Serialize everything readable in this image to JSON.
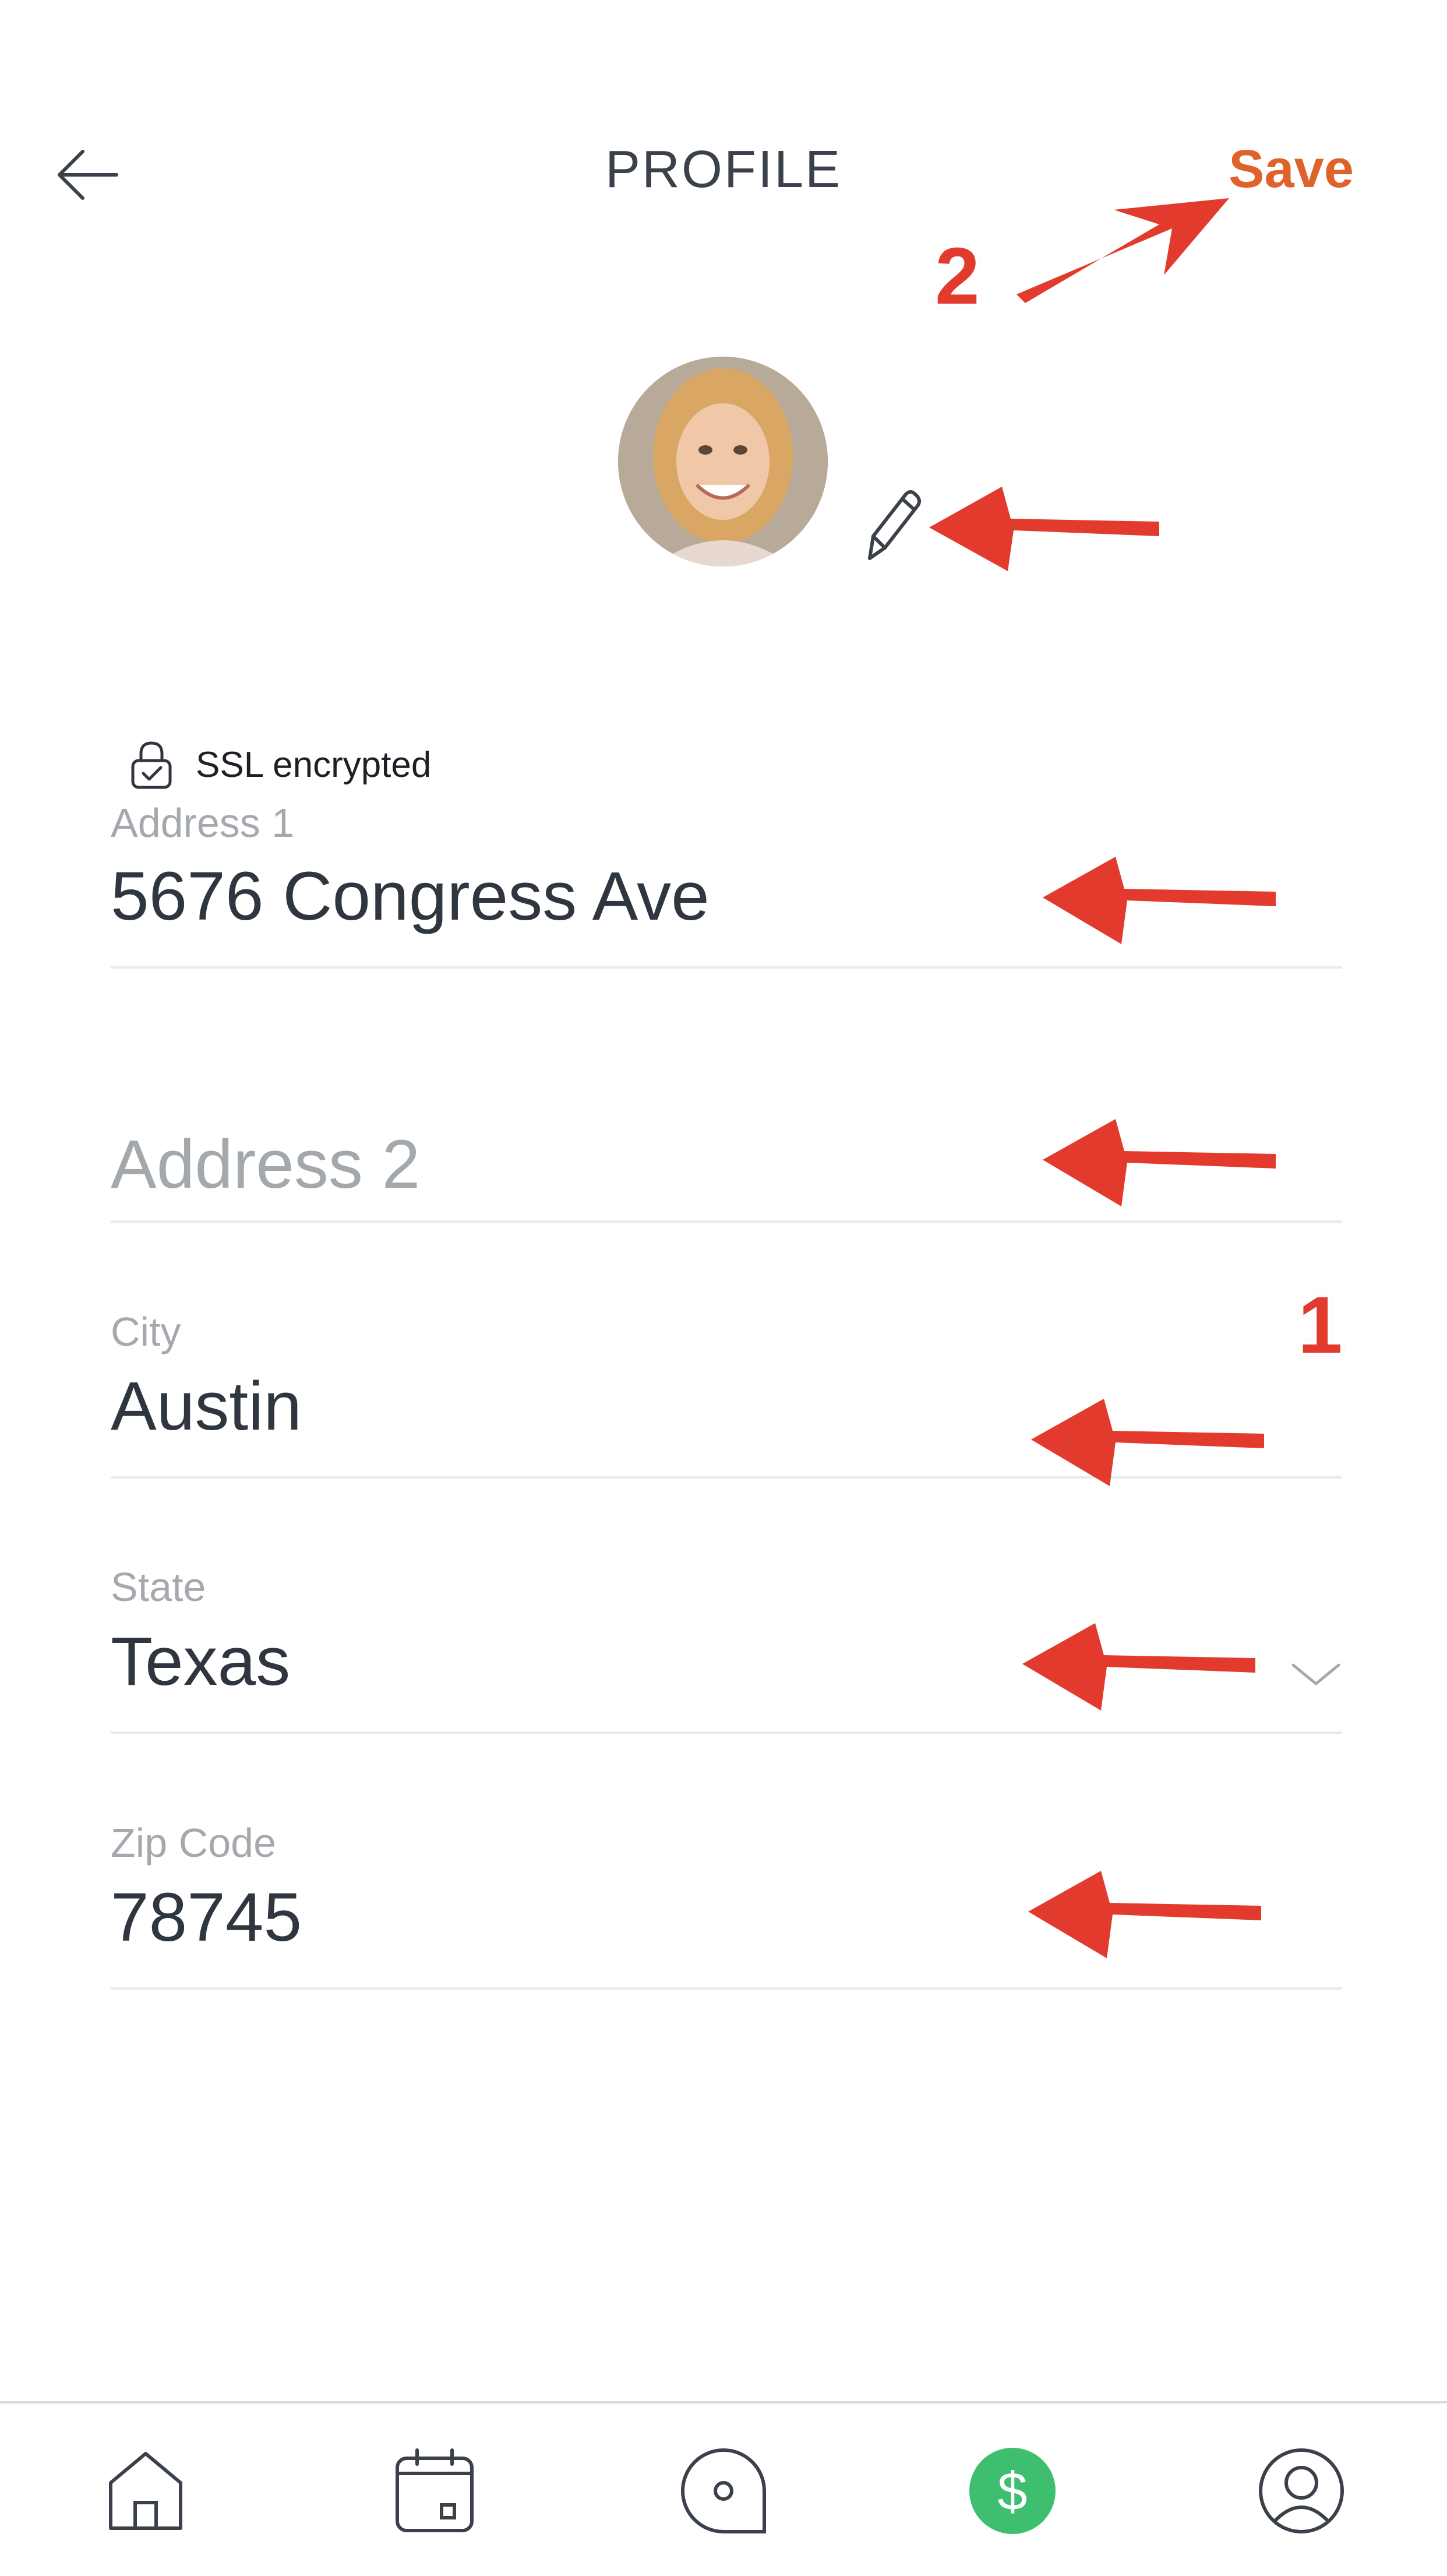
{
  "header": {
    "title": "PROFILE",
    "save_label": "Save",
    "back_icon": "arrow-left-icon"
  },
  "avatar": {
    "alt": "Profile photo",
    "edit_icon": "pencil-icon"
  },
  "security": {
    "icon": "lock-icon",
    "text": "SSL encrypted"
  },
  "form": {
    "address1": {
      "label": "Address 1",
      "value": "5676 Congress Ave"
    },
    "address2": {
      "placeholder": "Address 2",
      "value": ""
    },
    "city": {
      "label": "City",
      "value": "Austin"
    },
    "state": {
      "label": "State",
      "value": "Texas",
      "icon": "chevron-down-icon"
    },
    "zip": {
      "label": "Zip Code",
      "value": "78745"
    }
  },
  "annotations": {
    "step_one": "1",
    "step_two": "2",
    "arrow_color": "#e23b2e"
  },
  "bottom_nav": {
    "items": [
      {
        "icon": "home-icon"
      },
      {
        "icon": "calendar-icon"
      },
      {
        "icon": "chat-bubble-icon"
      },
      {
        "icon": "dollar-icon",
        "active": true,
        "color": "#3dbf6f"
      },
      {
        "icon": "profile-icon"
      }
    ]
  },
  "colors": {
    "accent": "#e0622b",
    "text": "#2f3640",
    "muted": "#a5a9ae",
    "divider": "#e8eaec"
  }
}
